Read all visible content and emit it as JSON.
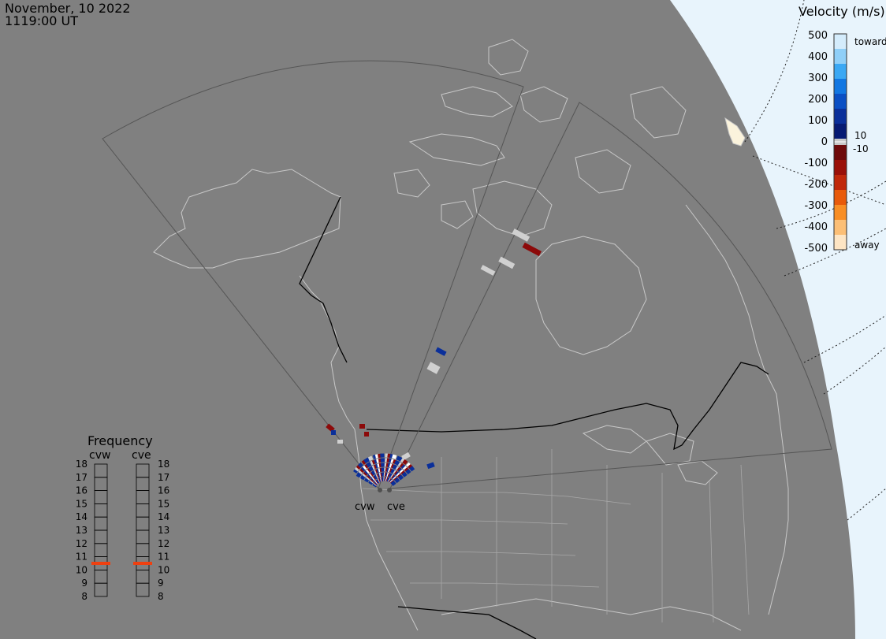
{
  "header": {
    "date": "November, 10 2022",
    "time": "1119:00 UT"
  },
  "colorbar": {
    "title": "Velocity (m/s)",
    "ticks": [
      "500",
      "400",
      "300",
      "200",
      "100",
      "0",
      "-100",
      "-200",
      "-300",
      "-400",
      "-500"
    ],
    "threshold_pos": "10",
    "threshold_neg": "-10",
    "top_label": "toward",
    "bottom_label": "away",
    "colors_toward": [
      "#d4ecfc",
      "#8fcff8",
      "#3aa8f4",
      "#1277e2",
      "#0a4fc4",
      "#0a2f9a",
      "#061a73"
    ],
    "colors_away": [
      "#6e0a0a",
      "#9a1008",
      "#c0280a",
      "#e85a0a",
      "#f88e24",
      "#fcbf76",
      "#fde5c4"
    ]
  },
  "radars": {
    "west_label": "cvw",
    "east_label": "cve"
  },
  "frequency": {
    "title": "Frequency",
    "col_left": "cvw",
    "col_right": "cve",
    "ticks": [
      "18",
      "17",
      "16",
      "15",
      "14",
      "13",
      "12",
      "11",
      "10",
      "9",
      "8"
    ],
    "cvw_mhz": 10.5,
    "cve_mhz": 10.5,
    "marker_color": "#ee4010"
  },
  "map_colors": {
    "land_ocean": "#808080",
    "boundaries": "#c8c8c8",
    "fov": "#555555",
    "night_edge": "#e8f4fc",
    "ground_scatter": "#d0d0d0"
  }
}
